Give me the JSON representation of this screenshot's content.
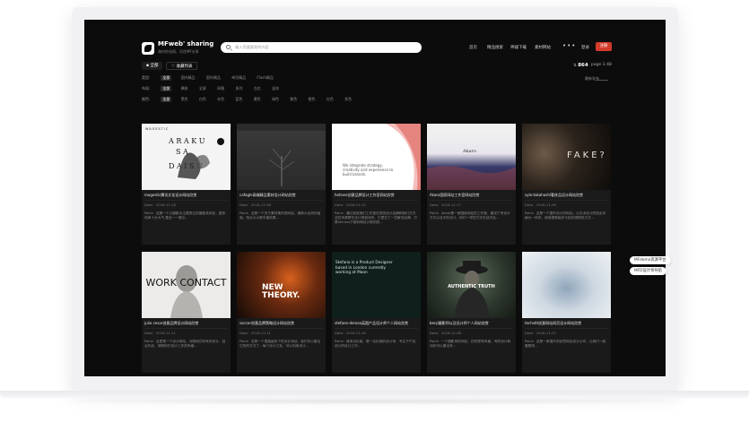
{
  "brand": {
    "name": "MFweb' sharing",
    "slogan": "海内外佳网，尽在MF分享"
  },
  "search": {
    "placeholder": "输入您要搜索的内容"
  },
  "nav": {
    "items": [
      "首页",
      "精品搜索",
      "神器下载",
      "素材网站"
    ],
    "more": "•••",
    "login": "登录",
    "register": "注册"
  },
  "filter": {
    "all_tab": "全部",
    "fav_tab": "收藏列表",
    "count_value": "864",
    "page_info": "page 1-48",
    "rows": [
      {
        "label": "类型:",
        "options": [
          "全部",
          "国内精品",
          "国外精品",
          "单页精品",
          "Flash精品"
        ]
      },
      {
        "label": "布局:",
        "options": [
          "全部",
          "横排",
          "全屏",
          "网格",
          "多列",
          "左右",
          "竖排"
        ]
      },
      {
        "label": "颜色:",
        "options": [
          "全部",
          "黑色",
          "白色",
          "灰色",
          "蓝色",
          "黄色",
          "绿色",
          "紫色",
          "橙色",
          "红色",
          "多色"
        ]
      }
    ],
    "sort_label": "最新发布"
  },
  "cards": [
    {
      "title": "magestic腾讯文化设计网站欣赏",
      "date": "Date：2016-12-18",
      "desc": "Point：这是一个以摄影为主要表达的摄影类网站，整体布局十分大气 富含一一展示。",
      "thumb_text": "WAGESTIC"
    },
    {
      "title": "cafagle高端精品素材设计网站欣赏",
      "date": "Date：2016-12-08",
      "desc": "Point：这是一个关于素材素材类网站，通常大自然的画面，特点以大屏丰盛效果...",
      "thumb_text": ""
    },
    {
      "title": "hehnes创意品牌设计工作室网站欣赏",
      "date": "Date：2016-11-22",
      "desc": "Point：通过投放我们工作室在视觉设计品牌和我们方式这些来源是在设计真相对的，它是位了一些解决品牌，它是hehnes于数码和设计原则的...",
      "thumb_text": "We integrate strategy, creativity and experience to build brands."
    },
    {
      "title": "Akaro国家网站工作室网站欣赏",
      "date": "Date：2016-11-17",
      "desc": "Point：Akaro是一家国家网站的工作室，建设了有设计方式以及中的设计，他们一样的方式去创作品...",
      "thumb_text": "Akaro"
    },
    {
      "title": "sylo-takahashi奢侈品设计网站欣赏",
      "date": "Date：2016-11-09",
      "desc": "Point：这是一个国外设计的网站，以艺术设计的知名风格为一体的，使用图像组织与色彩搭配的方式...",
      "thumb_text": "FAKE?"
    },
    {
      "title": "julio cesar创意品牌设计网站欣赏",
      "date": "Date：2016-11-11",
      "desc": "Point：这里是一个设计网站，对照他们所有的设计，结合作品，按照他们设计工作的风格...",
      "thumb_text": "WORK CONTACT"
    },
    {
      "title": "soccer创意品牌策略设计网站欣赏",
      "date": "Date：2016-12-11",
      "desc": "Point：这是一个很高级的个性设计网站，我们可以看出它所的方式了，每个设计之处，可以利用设计...",
      "thumb_text": "NEW THEORY."
    },
    {
      "title": "stefano-derosa英国产品设计师个人网站欣赏",
      "date": "Date：2016-11-09",
      "desc": "Point：我来自伦敦，是一名伦敦的设计师，专注于产品设计的设计工作...",
      "thumb_text": "Stefano is a Product Designer based in London currently working at Moon"
    },
    {
      "title": "benji摄影师以及设计师个人网站欣赏",
      "date": "Date：2016-12-08",
      "desc": "Point：一个摄影师的网站，拍的很有风格，有的设计和动作可以看出来...",
      "thumb_text": "AUTHENTIC TRUTH"
    },
    {
      "title": "techstit创意网站网页设计网站欣赏",
      "date": "Date：2016-11-07",
      "desc": "Point：这是一家国外的创意网站设计公司，让我们一起看着吧...",
      "thumb_text": ""
    }
  ],
  "side": {
    "pill_1": "MFdemo资源平台",
    "pill_2": "MFD设计师导航"
  },
  "colors": {
    "accent": "#d23a2a",
    "screen_bg": "#0c0c0c",
    "card_bg": "#1a1a1a"
  }
}
